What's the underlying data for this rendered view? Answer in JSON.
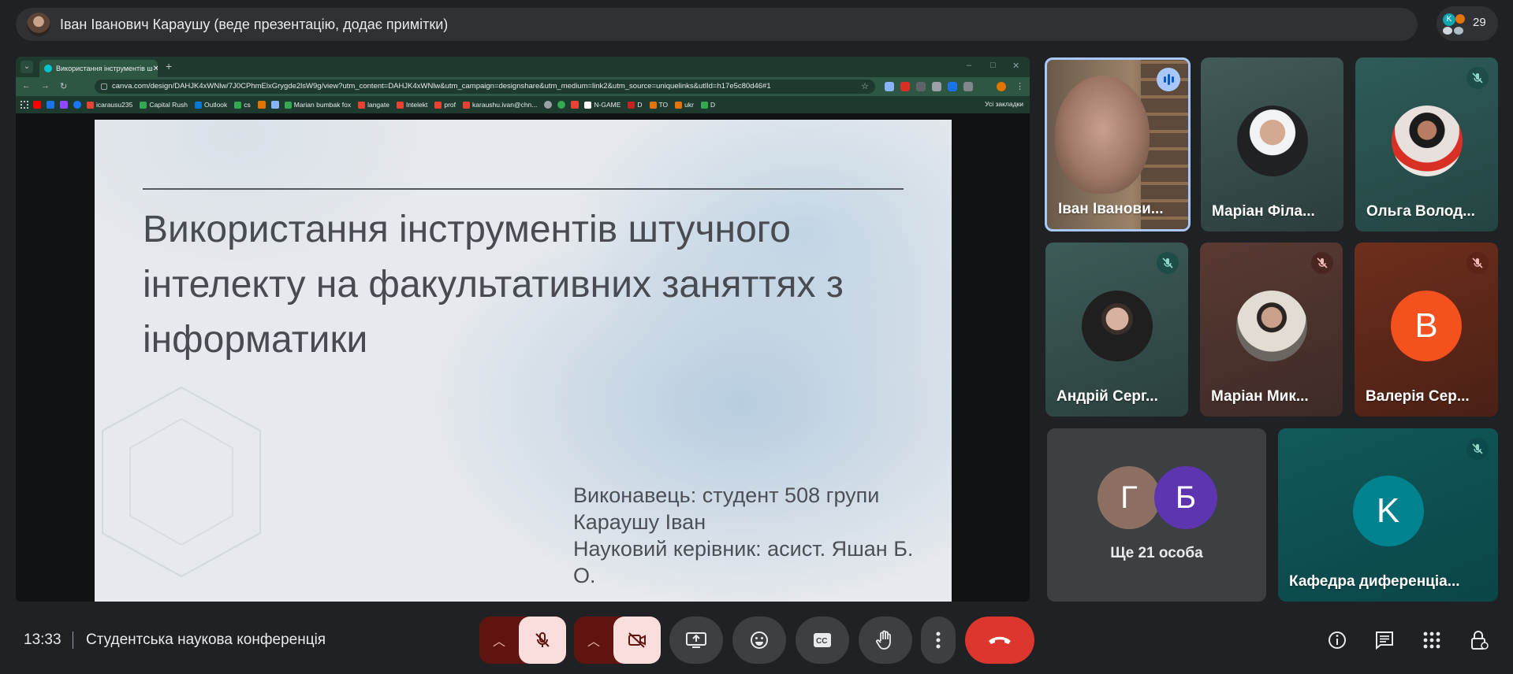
{
  "banner": {
    "presenter": "Іван Іванович Караушу (веде презентацію, додає примітки)"
  },
  "people": {
    "count": "29",
    "mini_avatar_letter": "K"
  },
  "browser": {
    "tab_title": "Використання інструментів ш",
    "url": "canva.com/design/DAHJK4xWNlw/7J0CPhmElxGrygde2lsW9g/view?utm_content=DAHJK4xWNlw&utm_campaign=designshare&utm_medium=link2&utm_source=uniquelinks&utlId=h17e5c80d46#1",
    "bookmarks": [
      "icarausu235",
      "Capital Rush",
      "Outlook",
      "cs",
      "Marian bumbak fox",
      "langate",
      "Intelekt",
      "prof",
      "karaushu.ivan@chn...",
      "N-GAME",
      "D",
      "TO",
      "ukr",
      "D"
    ],
    "all_bookmarks": "Усі закладки"
  },
  "slide": {
    "title": "Використання інструментів штучного інтелекту на факультативних заняттях з інформатики",
    "author_line1": "Виконавець: студент 508 групи",
    "author_line2": "Караушу Іван",
    "author_line3": "Науковий керівник: асист. Яшан Б. О."
  },
  "tiles": [
    {
      "name": "Іван Іванови...",
      "speaking": true
    },
    {
      "name": "Маріан Філа...",
      "muted": false
    },
    {
      "name": "Ольга Волод...",
      "muted": true
    },
    {
      "name": "Андрій Серг...",
      "muted": true
    },
    {
      "name": "Маріан Мик...",
      "muted": true
    },
    {
      "name": "Валерія Сер...",
      "muted": true,
      "letter": "В"
    },
    {
      "others_label": "Ще 21 особа",
      "letter1": "Г",
      "letter2": "Б"
    },
    {
      "name": "Кафедра диференціа...",
      "muted": true,
      "letter": "K"
    }
  ],
  "footer": {
    "time": "13:33",
    "meeting_title": "Студентська наукова конференція"
  },
  "colors": {
    "accent_blue": "#a8c7fa",
    "hangup_red": "#dc362e",
    "muted_bg": "#601410"
  }
}
